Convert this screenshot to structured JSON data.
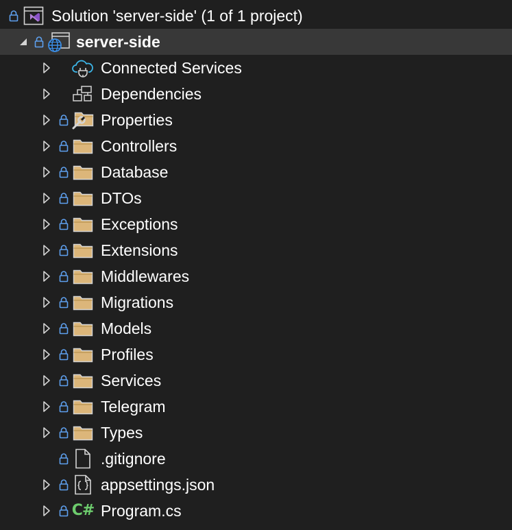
{
  "solution": {
    "label": "Solution 'server-side' (1 of 1 project)",
    "icon": "visual-studio-solution-icon"
  },
  "project": {
    "label": "server-side",
    "icon": "web-project-icon",
    "expanded": true
  },
  "items": [
    {
      "label": "Connected Services",
      "icon": "connected-services-icon",
      "expandable": true,
      "locked": false
    },
    {
      "label": "Dependencies",
      "icon": "dependencies-icon",
      "expandable": true,
      "locked": false
    },
    {
      "label": "Properties",
      "icon": "properties-folder-icon",
      "expandable": true,
      "locked": true
    },
    {
      "label": "Controllers",
      "icon": "folder-icon",
      "expandable": true,
      "locked": true
    },
    {
      "label": "Database",
      "icon": "folder-icon",
      "expandable": true,
      "locked": true
    },
    {
      "label": "DTOs",
      "icon": "folder-icon",
      "expandable": true,
      "locked": true
    },
    {
      "label": "Exceptions",
      "icon": "folder-icon",
      "expandable": true,
      "locked": true
    },
    {
      "label": "Extensions",
      "icon": "folder-icon",
      "expandable": true,
      "locked": true
    },
    {
      "label": "Middlewares",
      "icon": "folder-icon",
      "expandable": true,
      "locked": true
    },
    {
      "label": "Migrations",
      "icon": "folder-icon",
      "expandable": true,
      "locked": true
    },
    {
      "label": "Models",
      "icon": "folder-icon",
      "expandable": true,
      "locked": true
    },
    {
      "label": "Profiles",
      "icon": "folder-icon",
      "expandable": true,
      "locked": true
    },
    {
      "label": "Services",
      "icon": "folder-icon",
      "expandable": true,
      "locked": true
    },
    {
      "label": "Telegram",
      "icon": "folder-icon",
      "expandable": true,
      "locked": true
    },
    {
      "label": "Types",
      "icon": "folder-icon",
      "expandable": true,
      "locked": true
    },
    {
      "label": ".gitignore",
      "icon": "file-icon",
      "expandable": false,
      "locked": true
    },
    {
      "label": "appsettings.json",
      "icon": "json-file-icon",
      "expandable": true,
      "locked": true
    },
    {
      "label": "Program.cs",
      "icon": "csharp-file-icon",
      "expandable": true,
      "locked": true,
      "icon_text": "C#"
    }
  ],
  "colors": {
    "background": "#1f1f1f",
    "selected_row": "#383838",
    "lock": "#5ea0ef",
    "folder": "#dcb67a",
    "vs_purple": "#b180d7",
    "web_blue": "#3c8ee6",
    "cs_green": "#6dcc6d"
  }
}
